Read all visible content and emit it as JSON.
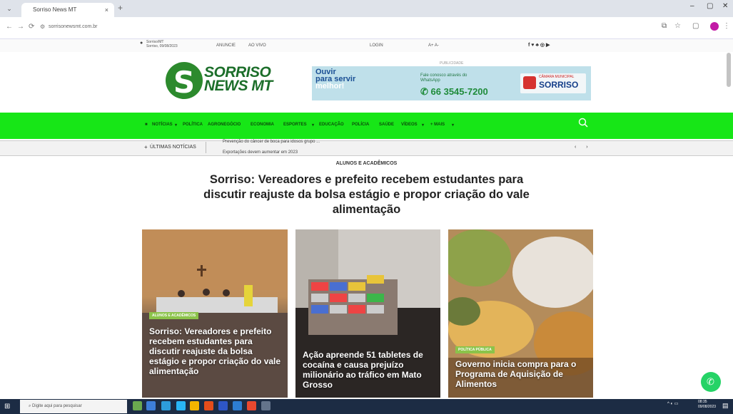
{
  "browser": {
    "tab_title": "Sorriso News MT",
    "tab_close": "×",
    "new_tab": "+",
    "url": "sorrisonewsmt.com.br",
    "window_controls": [
      "–",
      "▢",
      "✕"
    ]
  },
  "topbar": {
    "location": "Sorriso/MT",
    "date": "Sorriso, 09/08/2023",
    "links": [
      "ANUNCIE",
      "AO VIVO",
      "LOGIN",
      "A+ A-"
    ],
    "social": "f  ♥  ♣  ◎  ▶"
  },
  "header": {
    "logo_line1": "SORRISO",
    "logo_line2": "NEWS MT",
    "ad_label": "PUBLICIDADE",
    "banner": {
      "line1": "Ouvir",
      "line2": "para servir",
      "line3": "melhor!",
      "side_text": "Fale conosco através do WhatsApp",
      "phone": "66 3545-7200",
      "org_small": "CÂMARA MUNICIPAL",
      "org": "SORRISO"
    }
  },
  "nav": {
    "items": [
      "NOTÍCIAS",
      "POLÍTICA",
      "AGRONEGÓCIO",
      "ECONOMIA",
      "ESPORTES",
      "EDUCAÇÃO",
      "POLÍCIA",
      "SAÚDE",
      "VÍDEOS",
      "+ MAIS"
    ]
  },
  "ticker": {
    "label": "ÚLTIMAS NOTÍCIAS",
    "text1": "Prevenção do câncer de boca para idosos grupo ...",
    "text2": "Exportações devem aumentar em 2023",
    "arrows": "‹ ›"
  },
  "article": {
    "category": "ALUNOS E ACADÊMICOS",
    "headline": "Sorriso: Vereadores e prefeito recebem estudantes para discutir reajuste da bolsa estágio e propor criação do vale alimentação"
  },
  "cards": [
    {
      "badge": "ALUNOS E ACADÊMICOS",
      "title": "Sorriso: Vereadores e prefeito recebem estudantes para discutir reajuste da bolsa estágio e propor criação do vale alimentação"
    },
    {
      "badge": "",
      "title": "Ação apreende 51 tabletes de cocaína e causa prejuízo milionário ao tráfico em Mato Grosso"
    },
    {
      "badge": "POLÍTICA PÚBLICA",
      "title": "Governo inicia compra para o Programa de Aquisição de Alimentos"
    }
  ],
  "taskbar": {
    "search_placeholder": "Digite aqui para pesquisar",
    "time": "08:35",
    "date": "09/08/2023"
  },
  "colors": {
    "nav_green": "#17e617",
    "logo_green": "#2c8a2d",
    "taskbar": "#1c2c44",
    "whatsapp": "#25d366"
  }
}
